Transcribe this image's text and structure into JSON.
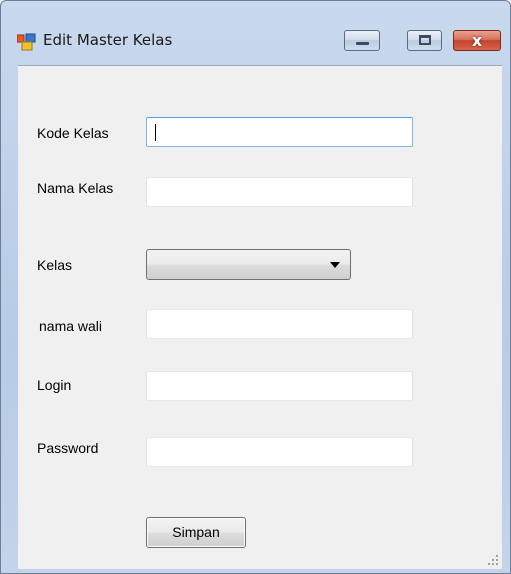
{
  "window": {
    "title": "Edit Master Kelas",
    "controls": {
      "minimize": "minimize",
      "maximize": "maximize",
      "close": "x"
    }
  },
  "form": {
    "kode_kelas": {
      "label": "Kode Kelas",
      "value": ""
    },
    "nama_kelas": {
      "label": "Nama Kelas",
      "value": ""
    },
    "kelas": {
      "label": "Kelas",
      "selected": ""
    },
    "nama_wali": {
      "label": "nama wali",
      "value": ""
    },
    "login": {
      "label": "Login",
      "value": ""
    },
    "password": {
      "label": "Password",
      "value": ""
    },
    "submit_label": "Simpan"
  },
  "icons": {
    "app": "form-window-icon",
    "minimize": "minimize-icon",
    "maximize": "maximize-icon",
    "close": "close-icon",
    "combo": "chevron-down-icon",
    "grip": "resize-grip-icon"
  },
  "colors": {
    "title_bar": "#c3d4ea",
    "client_background": "#f0f0f0",
    "close_button": "#c5452b",
    "focused_border": "#569de5"
  }
}
